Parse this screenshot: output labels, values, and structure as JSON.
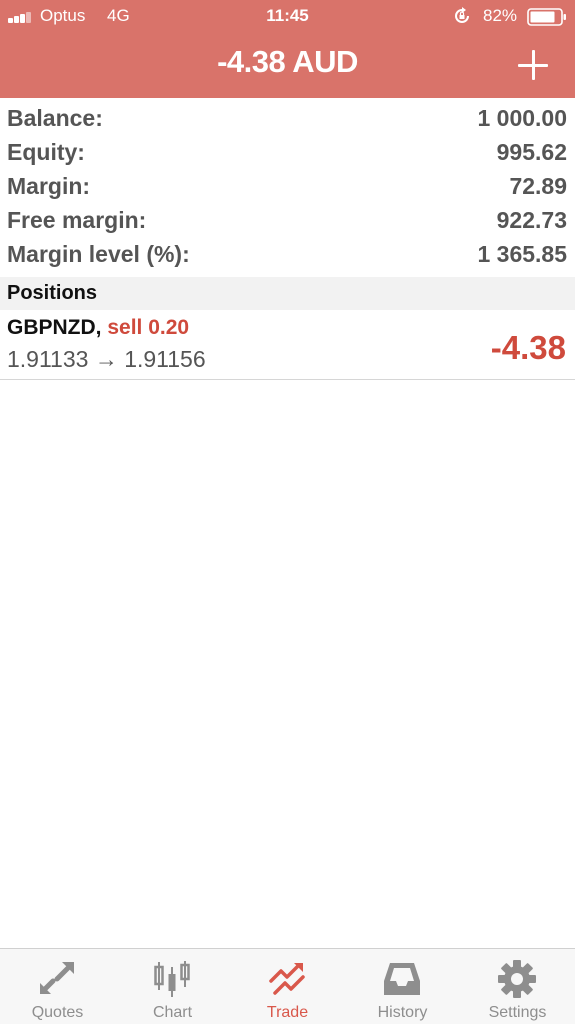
{
  "status_bar": {
    "carrier": "Optus",
    "network": "4G",
    "time": "11:45",
    "battery": "82%"
  },
  "header": {
    "title": "-4.38 AUD",
    "add_icon": "plus-icon",
    "background_color": "#d9736a"
  },
  "summary": [
    {
      "label": "Balance:",
      "value": "1 000.00"
    },
    {
      "label": "Equity:",
      "value": "995.62"
    },
    {
      "label": "Margin:",
      "value": "72.89"
    },
    {
      "label": "Free margin:",
      "value": "922.73"
    },
    {
      "label": "Margin level (%):",
      "value": "1 365.85"
    }
  ],
  "positions": {
    "header": "Positions",
    "items": [
      {
        "symbol": "GBPNZD",
        "separator": ",",
        "side": "sell 0.20",
        "prices": "1.91133 → 1.91156",
        "profit": "-4.38",
        "profit_color": "#cf4a3c"
      }
    ]
  },
  "tabbar": {
    "active_color": "#d9584b",
    "tabs": [
      {
        "label": "Quotes",
        "icon": "quotes-arrows-icon"
      },
      {
        "label": "Chart",
        "icon": "candlestick-chart-icon"
      },
      {
        "label": "Trade",
        "icon": "trade-trend-icon",
        "active": true
      },
      {
        "label": "History",
        "icon": "inbox-tray-icon"
      },
      {
        "label": "Settings",
        "icon": "gear-icon"
      }
    ]
  }
}
